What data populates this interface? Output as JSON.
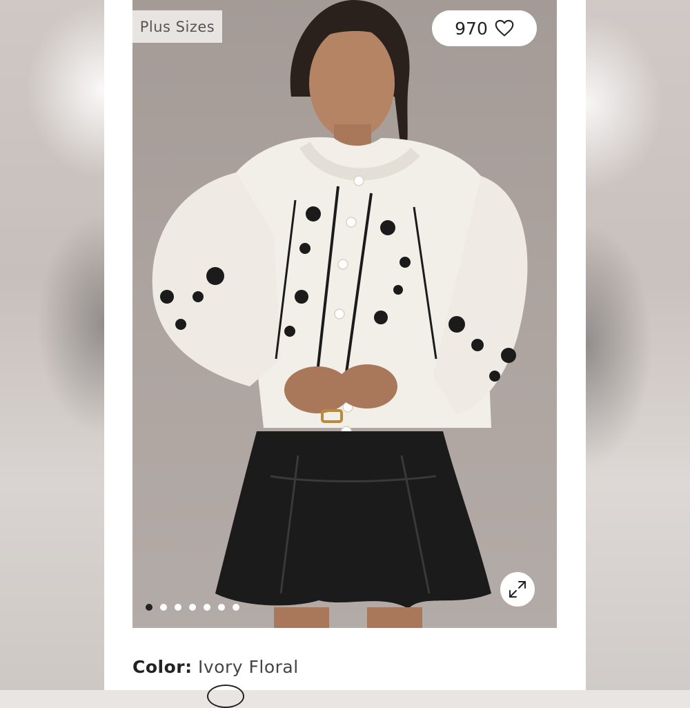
{
  "badge": {
    "label": "Plus Sizes"
  },
  "favorites": {
    "count": "970",
    "icon": "heart-outline-icon"
  },
  "gallery": {
    "total_images": 7,
    "active_index": 0,
    "expand_icon": "expand-arrows-icon"
  },
  "product": {
    "color_label": "Color:",
    "color_value": "Ivory Floral"
  },
  "colors": {
    "photo_background": "#a9a09c",
    "sweater": "#f2efe8",
    "skirt": "#1c1b1b",
    "text": "#222222"
  }
}
